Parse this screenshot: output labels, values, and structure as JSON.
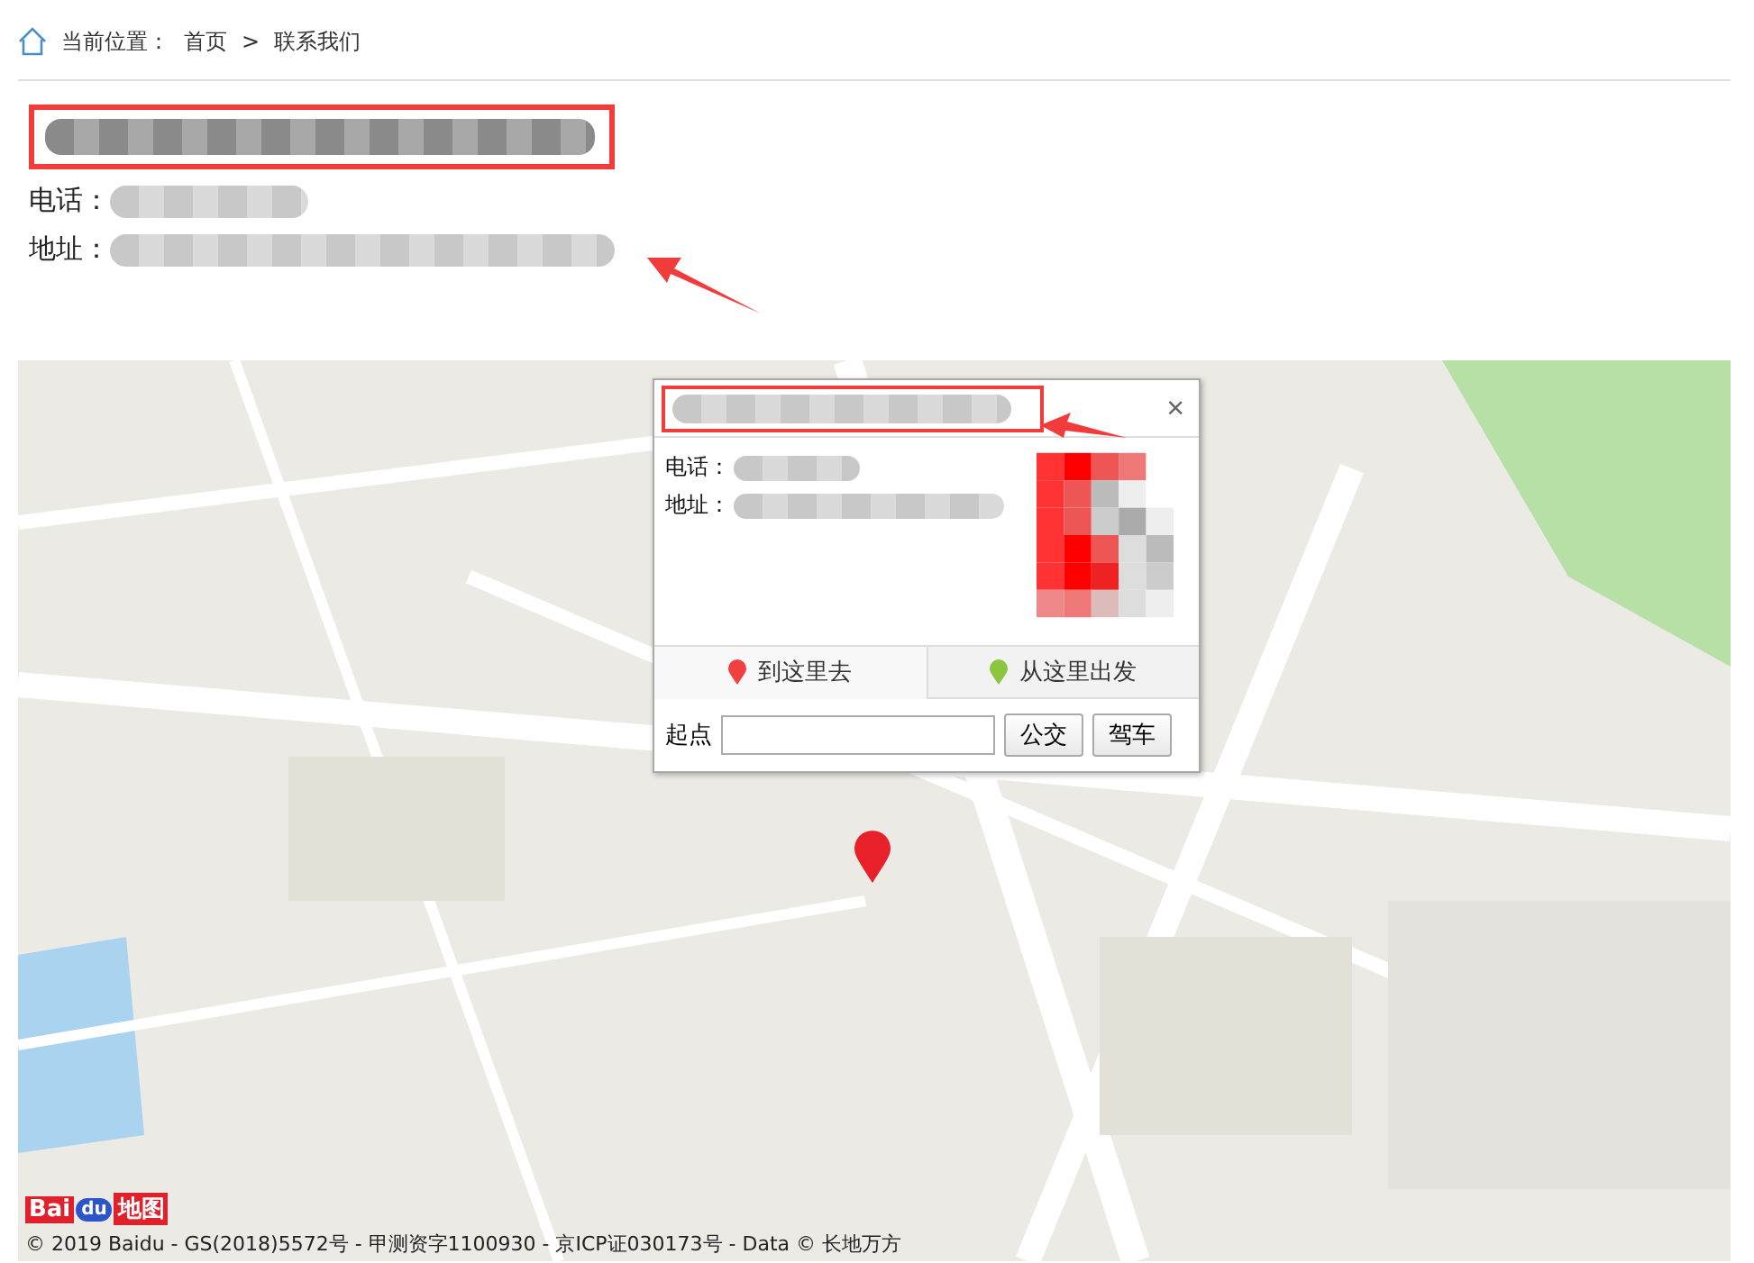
{
  "breadcrumb": {
    "label": "当前位置：",
    "items": [
      "首页",
      "联系我们"
    ],
    "separator": ">"
  },
  "contact": {
    "phone_label": "电话：",
    "address_label": "地址："
  },
  "popup": {
    "close": "×",
    "phone_label": "电话：",
    "address_label": "地址：",
    "tabs": [
      {
        "label": "到这里去",
        "selected": true,
        "color": "#f04040"
      },
      {
        "label": "从这里出发",
        "selected": false,
        "color": "#8cc63f"
      }
    ],
    "start_label": "起点",
    "buttons": [
      "公交",
      "驾车"
    ]
  },
  "map": {
    "kind": "picture",
    "logo": [
      "Bai",
      "du",
      "地图"
    ],
    "copyright": "© 2019 Baidu - GS(2018)5572号 - 甲测资字1100930 - 京ICP证030173号 - Data © 长地万方"
  }
}
